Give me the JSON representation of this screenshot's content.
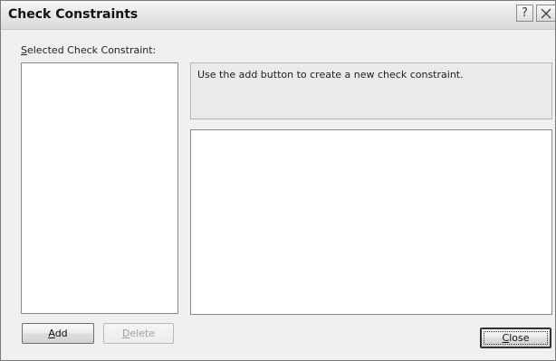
{
  "window": {
    "title": "Check Constraints",
    "help_button": "?"
  },
  "left_panel": {
    "label_mnemonic": "S",
    "label_rest": "elected Check Constraint:",
    "items": []
  },
  "info": {
    "text": "Use the add button to create a new check constraint."
  },
  "buttons": {
    "add_mnemonic": "A",
    "add_rest": "dd",
    "add_enabled": true,
    "delete_mnemonic": "D",
    "delete_rest": "elete",
    "delete_enabled": false,
    "close_mnemonic": "C",
    "close_rest": "lose"
  }
}
